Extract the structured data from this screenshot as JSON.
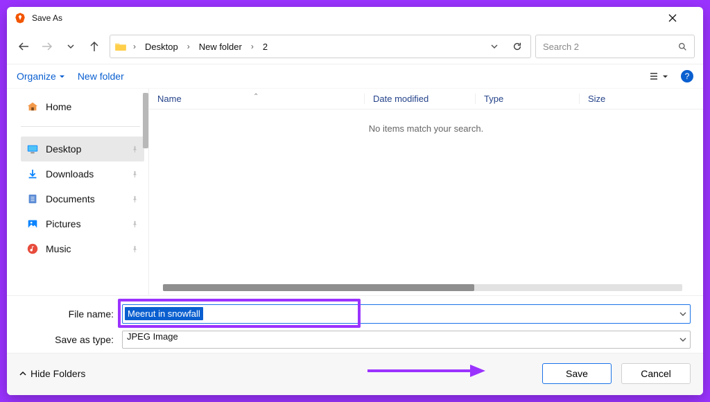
{
  "window": {
    "title": "Save As"
  },
  "breadcrumb": {
    "items": [
      "Desktop",
      "New folder",
      "2"
    ]
  },
  "search": {
    "placeholder": "Search 2"
  },
  "toolbar": {
    "organize": "Organize",
    "new_folder": "New folder"
  },
  "sidebar": {
    "home": "Home",
    "items": [
      {
        "icon": "desktop",
        "label": "Desktop",
        "selected": true
      },
      {
        "icon": "download",
        "label": "Downloads",
        "selected": false
      },
      {
        "icon": "document",
        "label": "Documents",
        "selected": false
      },
      {
        "icon": "pictures",
        "label": "Pictures",
        "selected": false
      },
      {
        "icon": "music",
        "label": "Music",
        "selected": false
      }
    ]
  },
  "columns": {
    "name": "Name",
    "date": "Date modified",
    "type": "Type",
    "size": "Size"
  },
  "empty_message": "No items match your search.",
  "form": {
    "file_name_label": "File name:",
    "file_name_value": "Meerut in snowfall",
    "save_type_label": "Save as type:",
    "save_type_value": "JPEG Image"
  },
  "footer": {
    "hide_folders": "Hide Folders",
    "save": "Save",
    "cancel": "Cancel"
  }
}
